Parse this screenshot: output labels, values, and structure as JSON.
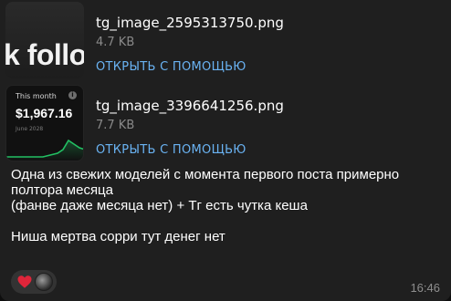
{
  "attachments": [
    {
      "thumbnail_text": "k follo",
      "filename": "tg_image_2595313750.png",
      "size": "4.7 KB",
      "action": "ОТКРЫТЬ С ПОМОЩЬЮ"
    },
    {
      "thumbnail": {
        "heading": "This month",
        "amount": "$1,967.16",
        "date": "June 2028"
      },
      "filename": "tg_image_3396641256.png",
      "size": "7.7 KB",
      "action": "ОТКРЫТЬ С ПОМОЩЬЮ"
    }
  ],
  "message": {
    "line1": "Одна из свежих моделей с момента первого поста примерно",
    "line2": "полтора месяца",
    "line3": "(фанве даже месяца нет) + Тг есть чутка кеша",
    "line4": "Ниша мертва сорри тут денег нет"
  },
  "reactions": [
    {
      "icon": "heart-icon",
      "color": "#e0253a"
    },
    {
      "icon": "avatar"
    }
  ],
  "time": "16:46",
  "colors": {
    "bubble": "#1f1f1f",
    "link": "#6ab3f3",
    "muted": "#8a8a8a"
  }
}
